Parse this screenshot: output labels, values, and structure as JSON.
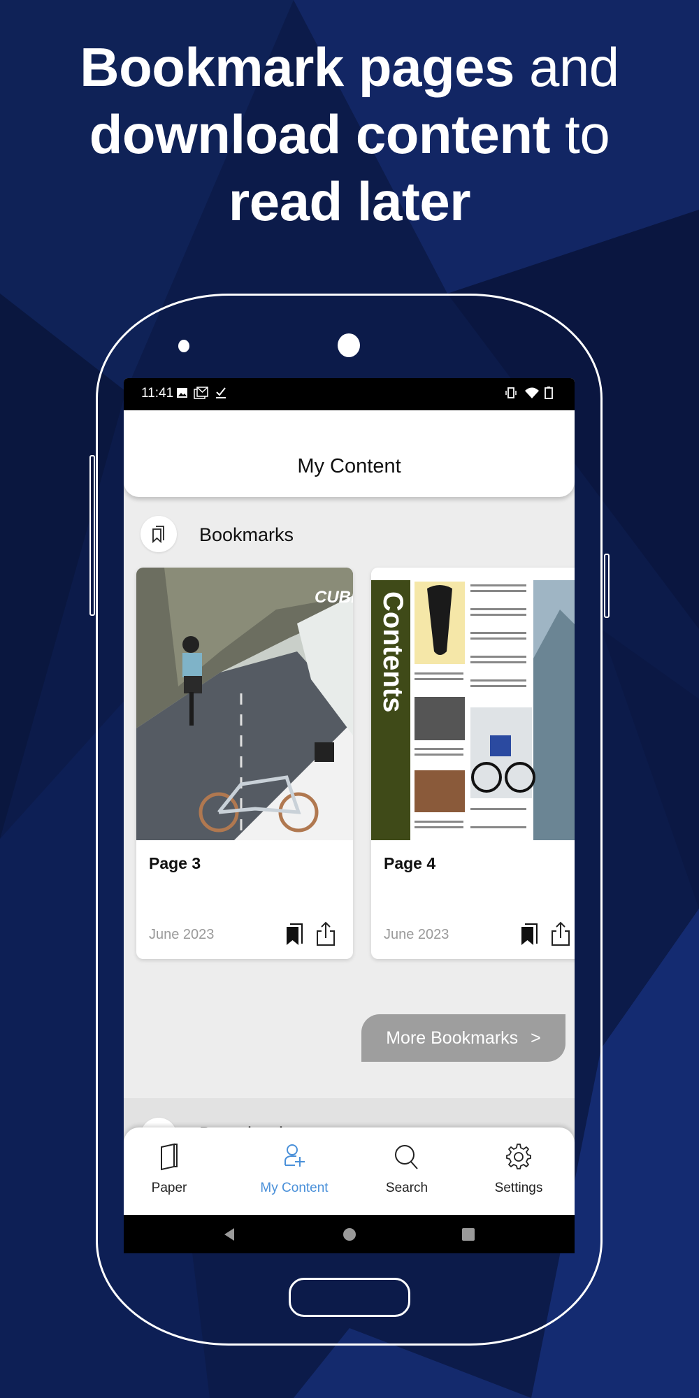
{
  "headline": {
    "line1_bold": "Bookmark pages",
    "line1_light": " and",
    "line2_bold": "download content",
    "line2_light": " to",
    "line3_bold": "read later"
  },
  "statusbar": {
    "time": "11:41",
    "left_icons": [
      "image-icon",
      "gmail-icon",
      "task-done-icon"
    ],
    "right_icons": [
      "vibrate-icon",
      "wifi-icon",
      "battery-icon"
    ]
  },
  "header": {
    "title": "My Content"
  },
  "bookmarks": {
    "section_label": "Bookmarks",
    "items": [
      {
        "title": "Page 3",
        "date": "June 2023",
        "thumbnail": "Cube bike advert (cyclist in tunnel)",
        "thumb_text": "CUBE"
      },
      {
        "title": "Page 4",
        "date": "June 2023",
        "thumbnail": "Cyclist magazine contents page",
        "thumb_text": "Contents"
      }
    ],
    "more_label": "More Bookmarks",
    "more_chevron": ">"
  },
  "downloads": {
    "section_label": "Downloads"
  },
  "bottom_nav": {
    "items": [
      {
        "label": "Paper",
        "icon": "book-icon",
        "active": false
      },
      {
        "label": "My Content",
        "icon": "user-plus-icon",
        "active": true
      },
      {
        "label": "Search",
        "icon": "search-icon",
        "active": false
      },
      {
        "label": "Settings",
        "icon": "gear-icon",
        "active": false
      }
    ],
    "active_color": "#4a90d9"
  },
  "system_nav": [
    "back-icon",
    "home-icon",
    "recents-icon"
  ]
}
